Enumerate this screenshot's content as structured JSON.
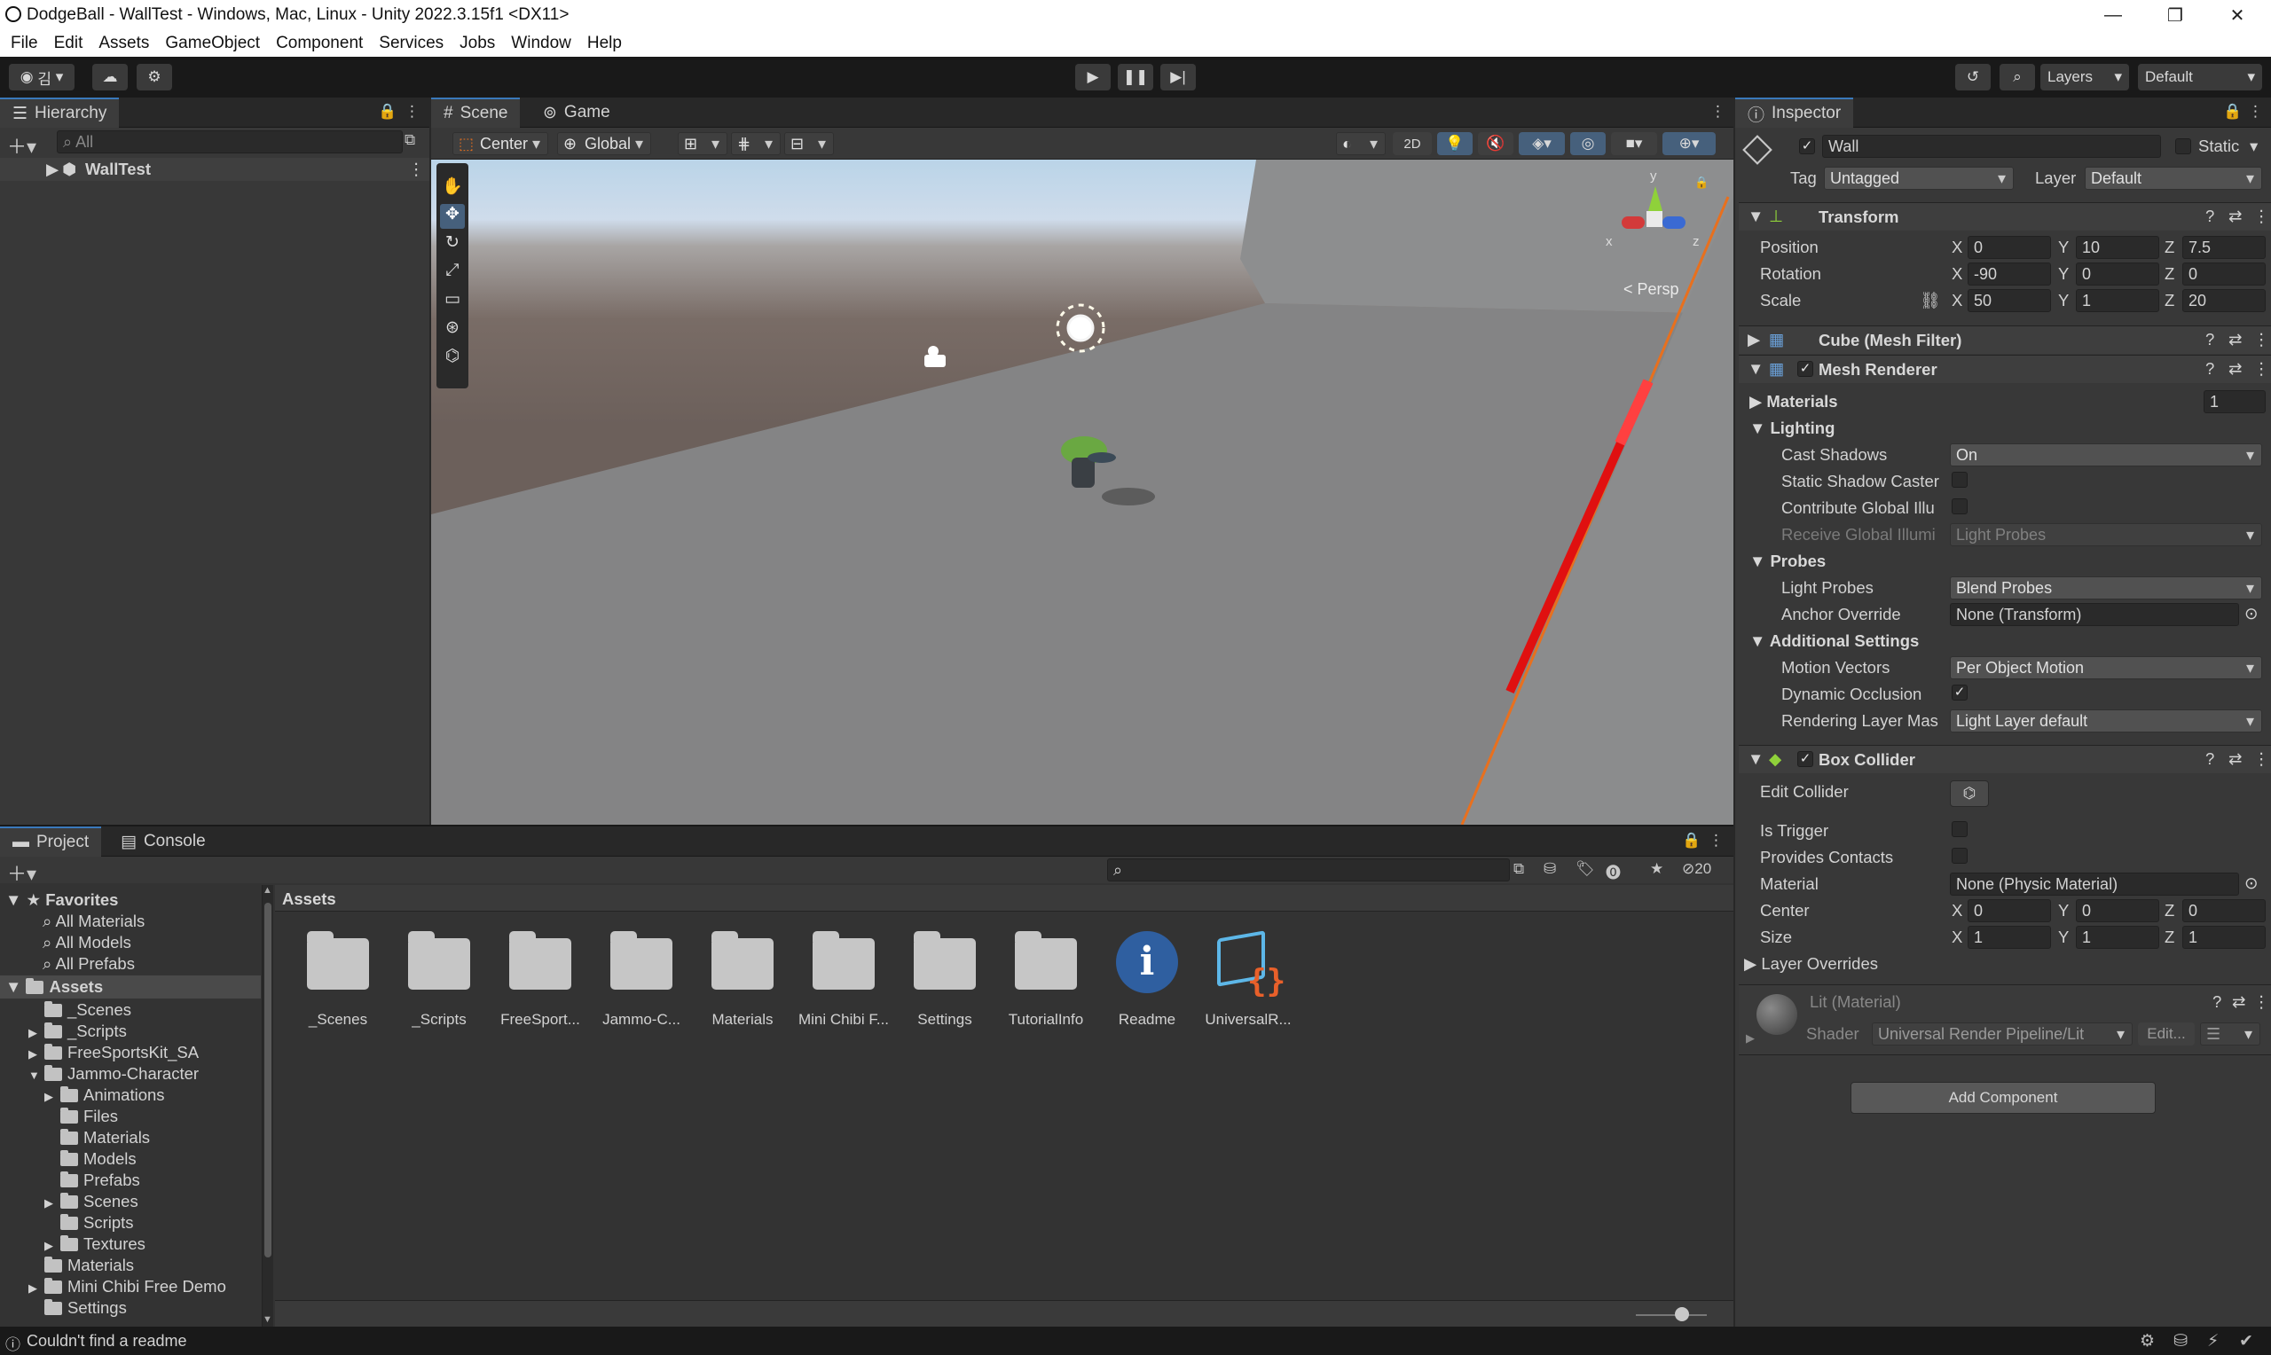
{
  "window": {
    "title": "DodgeBall - WallTest - Windows, Mac, Linux - Unity 2022.3.15f1 <DX11>"
  },
  "menu": [
    "File",
    "Edit",
    "Assets",
    "GameObject",
    "Component",
    "Services",
    "Jobs",
    "Window",
    "Help"
  ],
  "toolbar": {
    "layers": "Layers",
    "layout": "Default",
    "account_initial": "김"
  },
  "hierarchy": {
    "tab": "Hierarchy",
    "search_placeholder": "All",
    "root": "WallTest"
  },
  "scene": {
    "tabs": [
      "Scene",
      "Game"
    ],
    "pivot": "Center",
    "space": "Global",
    "mode_2d": "2D",
    "persp": "Persp",
    "gizmo_axes": {
      "x": "x",
      "y": "y",
      "z": "z"
    }
  },
  "inspector": {
    "tab": "Inspector",
    "object_name": "Wall",
    "static_label": "Static",
    "tag_label": "Tag",
    "tag_value": "Untagged",
    "layer_label": "Layer",
    "layer_value": "Default",
    "transform": {
      "title": "Transform",
      "position": {
        "label": "Position",
        "x": "0",
        "y": "10",
        "z": "7.5"
      },
      "rotation": {
        "label": "Rotation",
        "x": "-90",
        "y": "0",
        "z": "0"
      },
      "scale": {
        "label": "Scale",
        "x": "50",
        "y": "1",
        "z": "20"
      }
    },
    "mesh_filter": {
      "title": "Cube (Mesh Filter)"
    },
    "mesh_renderer": {
      "title": "Mesh Renderer",
      "materials_label": "Materials",
      "materials_count": "1",
      "lighting": "Lighting",
      "cast_shadows_label": "Cast Shadows",
      "cast_shadows_value": "On",
      "static_shadow_label": "Static Shadow Caster",
      "contribute_gi_label": "Contribute Global Illu",
      "receive_gi_label": "Receive Global Illumi",
      "receive_gi_value": "Light Probes",
      "probes": "Probes",
      "light_probes_label": "Light Probes",
      "light_probes_value": "Blend Probes",
      "anchor_label": "Anchor Override",
      "anchor_value": "None (Transform)",
      "additional": "Additional Settings",
      "motion_label": "Motion Vectors",
      "motion_value": "Per Object Motion",
      "dyn_occ_label": "Dynamic Occlusion",
      "rendering_layer_label": "Rendering Layer Mas",
      "rendering_layer_value": "Light Layer default"
    },
    "box_collider": {
      "title": "Box Collider",
      "edit_label": "Edit Collider",
      "trigger_label": "Is Trigger",
      "contacts_label": "Provides Contacts",
      "material_label": "Material",
      "material_value": "None (Physic Material)",
      "center": {
        "label": "Center",
        "x": "0",
        "y": "0",
        "z": "0"
      },
      "size": {
        "label": "Size",
        "x": "1",
        "y": "1",
        "z": "1"
      },
      "overrides": "Layer Overrides"
    },
    "material": {
      "name": "Lit (Material)",
      "shader_label": "Shader",
      "shader_value": "Universal Render Pipeline/Lit",
      "edit": "Edit..."
    },
    "add_component": "Add Component",
    "axis": {
      "x": "X",
      "y": "Y",
      "z": "Z"
    }
  },
  "project": {
    "tabs": [
      "Project",
      "Console"
    ],
    "favorites": "Favorites",
    "fav_items": [
      "All Materials",
      "All Models",
      "All Prefabs"
    ],
    "assets_root": "Assets",
    "tree": [
      {
        "label": "_Scenes",
        "indent": 1,
        "arrow": false
      },
      {
        "label": "_Scripts",
        "indent": 1,
        "arrow": true
      },
      {
        "label": "FreeSportsKit_SA",
        "indent": 1,
        "arrow": true
      },
      {
        "label": "Jammo-Character",
        "indent": 1,
        "arrow": "open"
      },
      {
        "label": "Animations",
        "indent": 2,
        "arrow": true
      },
      {
        "label": "Files",
        "indent": 2,
        "arrow": false
      },
      {
        "label": "Materials",
        "indent": 2,
        "arrow": false
      },
      {
        "label": "Models",
        "indent": 2,
        "arrow": false
      },
      {
        "label": "Prefabs",
        "indent": 2,
        "arrow": false
      },
      {
        "label": "Scenes",
        "indent": 2,
        "arrow": true
      },
      {
        "label": "Scripts",
        "indent": 2,
        "arrow": false
      },
      {
        "label": "Textures",
        "indent": 2,
        "arrow": true
      },
      {
        "label": "Materials",
        "indent": 1,
        "arrow": false
      },
      {
        "label": "Mini Chibi Free Demo",
        "indent": 1,
        "arrow": true
      },
      {
        "label": "Settings",
        "indent": 1,
        "arrow": false
      }
    ],
    "breadcrumb": "Assets",
    "hidden_count": "20",
    "assets": [
      "_Scenes",
      "_Scripts",
      "FreeSport...",
      "Jammo-C...",
      "Materials",
      "Mini Chibi F...",
      "Settings",
      "TutorialInfo",
      "Readme",
      "UniversalR..."
    ]
  },
  "status": {
    "message": "Couldn't find a readme"
  },
  "colors": {
    "accent": "#3a79bb",
    "wall_edge": "#e8701e",
    "collider_red": "#e01010"
  }
}
